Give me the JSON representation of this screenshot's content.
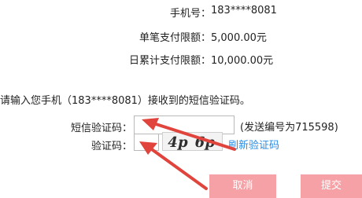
{
  "account": {
    "phone_label": "手机号：",
    "phone_value": "183****8081",
    "single_limit_label": "单笔支付限额：",
    "single_limit_value": "5,000.00元",
    "daily_limit_label": "日累计支付限额：",
    "daily_limit_value": "10,000.00元"
  },
  "instruction": "请输入您手机（183****8081）接收到的短信验证码。",
  "form": {
    "sms_code_label": "短信验证码：",
    "sms_code_value": "",
    "send_number_note": "(发送编号为715598)",
    "captcha_label": "验证码：",
    "captcha_value": "",
    "captcha_image_text": "4p 6p",
    "refresh_captcha_link": "刷新验证码"
  },
  "buttons": {
    "cancel_label": "取消",
    "submit_label": "提交"
  },
  "colors": {
    "button_bg": "#f6a1a6",
    "link": "#2b8be0",
    "arrow": "#e0443c"
  }
}
